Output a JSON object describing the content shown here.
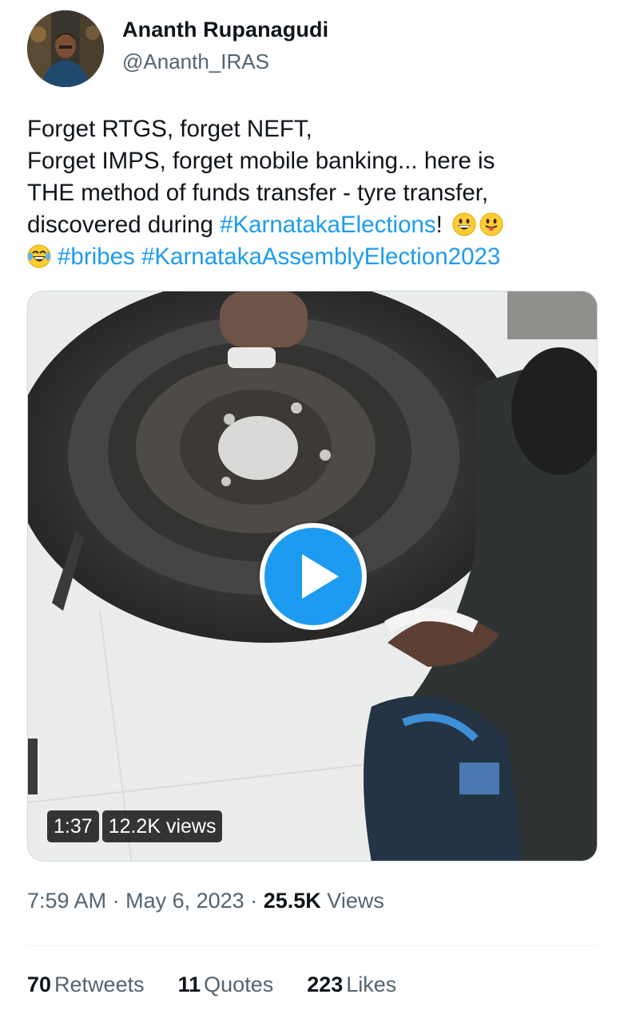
{
  "author": {
    "name": "Ananth Rupanagudi",
    "handle": "@Ananth_IRAS"
  },
  "tweet": {
    "line1": "Forget RTGS, forget NEFT,",
    "line2": "Forget IMPS, forget mobile banking... here is",
    "line3": "THE method of funds transfer - tyre transfer,",
    "line4_prefix": "discovered during ",
    "hashtag_karnataka": "#KarnatakaElections",
    "line4_suffix": "!",
    "hashtag_bribes": "#bribes",
    "hashtag_assembly": "#KarnatakaAssemblyElection2023",
    "emojis": [
      "grinning-face",
      "face-with-tongue",
      "face-with-tears-of-joy"
    ]
  },
  "media": {
    "duration": "1:37",
    "views": "12.2K views"
  },
  "meta": {
    "time": "7:59 AM",
    "separator": "·",
    "date": "May 6, 2023",
    "views_count": "25.5K",
    "views_label": "Views"
  },
  "stats": {
    "retweets_count": "70",
    "retweets_label": "Retweets",
    "quotes_count": "11",
    "quotes_label": "Quotes",
    "likes_count": "223",
    "likes_label": "Likes"
  },
  "colors": {
    "link": "#1d9bf0",
    "secondary_text": "#536471",
    "primary_text": "#0f1419"
  }
}
